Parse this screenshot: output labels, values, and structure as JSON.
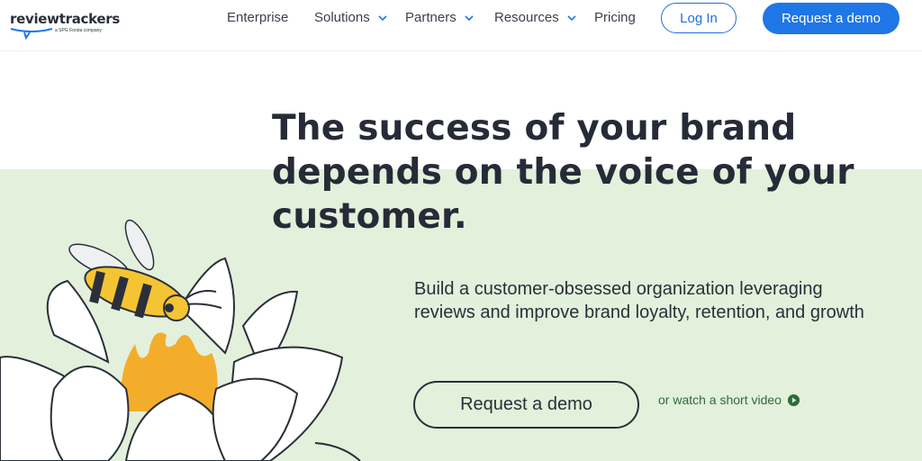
{
  "brand": {
    "name": "reviewtrackers",
    "tagline": "a SPG Forsta company"
  },
  "nav": {
    "items": [
      {
        "label": "Enterprise",
        "has_dropdown": false
      },
      {
        "label": "Solutions",
        "has_dropdown": true
      },
      {
        "label": "Partners",
        "has_dropdown": true
      },
      {
        "label": "Resources",
        "has_dropdown": true
      },
      {
        "label": "Pricing",
        "has_dropdown": false
      }
    ],
    "login_label": "Log In",
    "demo_label": "Request a demo"
  },
  "hero": {
    "headline": "The success of your brand depends on the voice of your customer.",
    "subtext": "Build a customer-obsessed organization leveraging reviews and improve brand loyalty, retention, and growth",
    "cta_label": "Request a demo",
    "video_link_label": "or watch a short video",
    "illustration": "bee-on-lotus-flower"
  },
  "colors": {
    "accent_blue": "#1f76e6",
    "hero_background": "#e3f0db",
    "text_dark": "#262b37",
    "link_green": "#2f6b3a"
  }
}
